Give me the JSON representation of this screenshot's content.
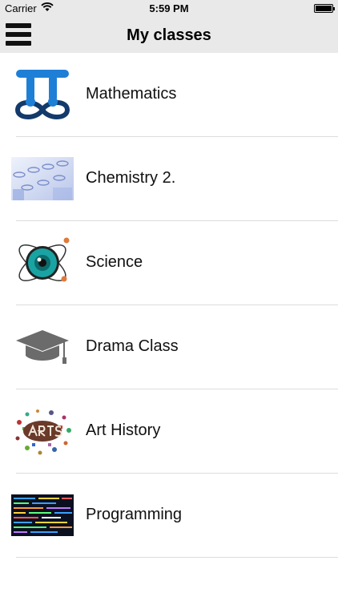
{
  "status_bar": {
    "carrier": "Carrier",
    "time": "5:59 PM",
    "wifi_icon": "wifi-icon",
    "battery_icon": "battery-icon"
  },
  "nav": {
    "title": "My classes",
    "menu_icon": "hamburger-menu-icon"
  },
  "classes": [
    {
      "label": "Mathematics",
      "icon": "pi-infinity-icon"
    },
    {
      "label": "Chemistry 2.",
      "icon": "test-tubes-icon"
    },
    {
      "label": "Science",
      "icon": "atom-eye-icon"
    },
    {
      "label": "Drama Class",
      "icon": "graduation-cap-icon"
    },
    {
      "label": "Art History",
      "icon": "arts-collage-icon"
    },
    {
      "label": "Programming",
      "icon": "code-screen-icon"
    }
  ],
  "colors": {
    "bar_background": "#e9e9e9",
    "divider": "#dcdcdc",
    "math_blue": "#1e7fd6",
    "cap_gray": "#6b6b6b",
    "eye_teal": "#1aa3a3"
  }
}
